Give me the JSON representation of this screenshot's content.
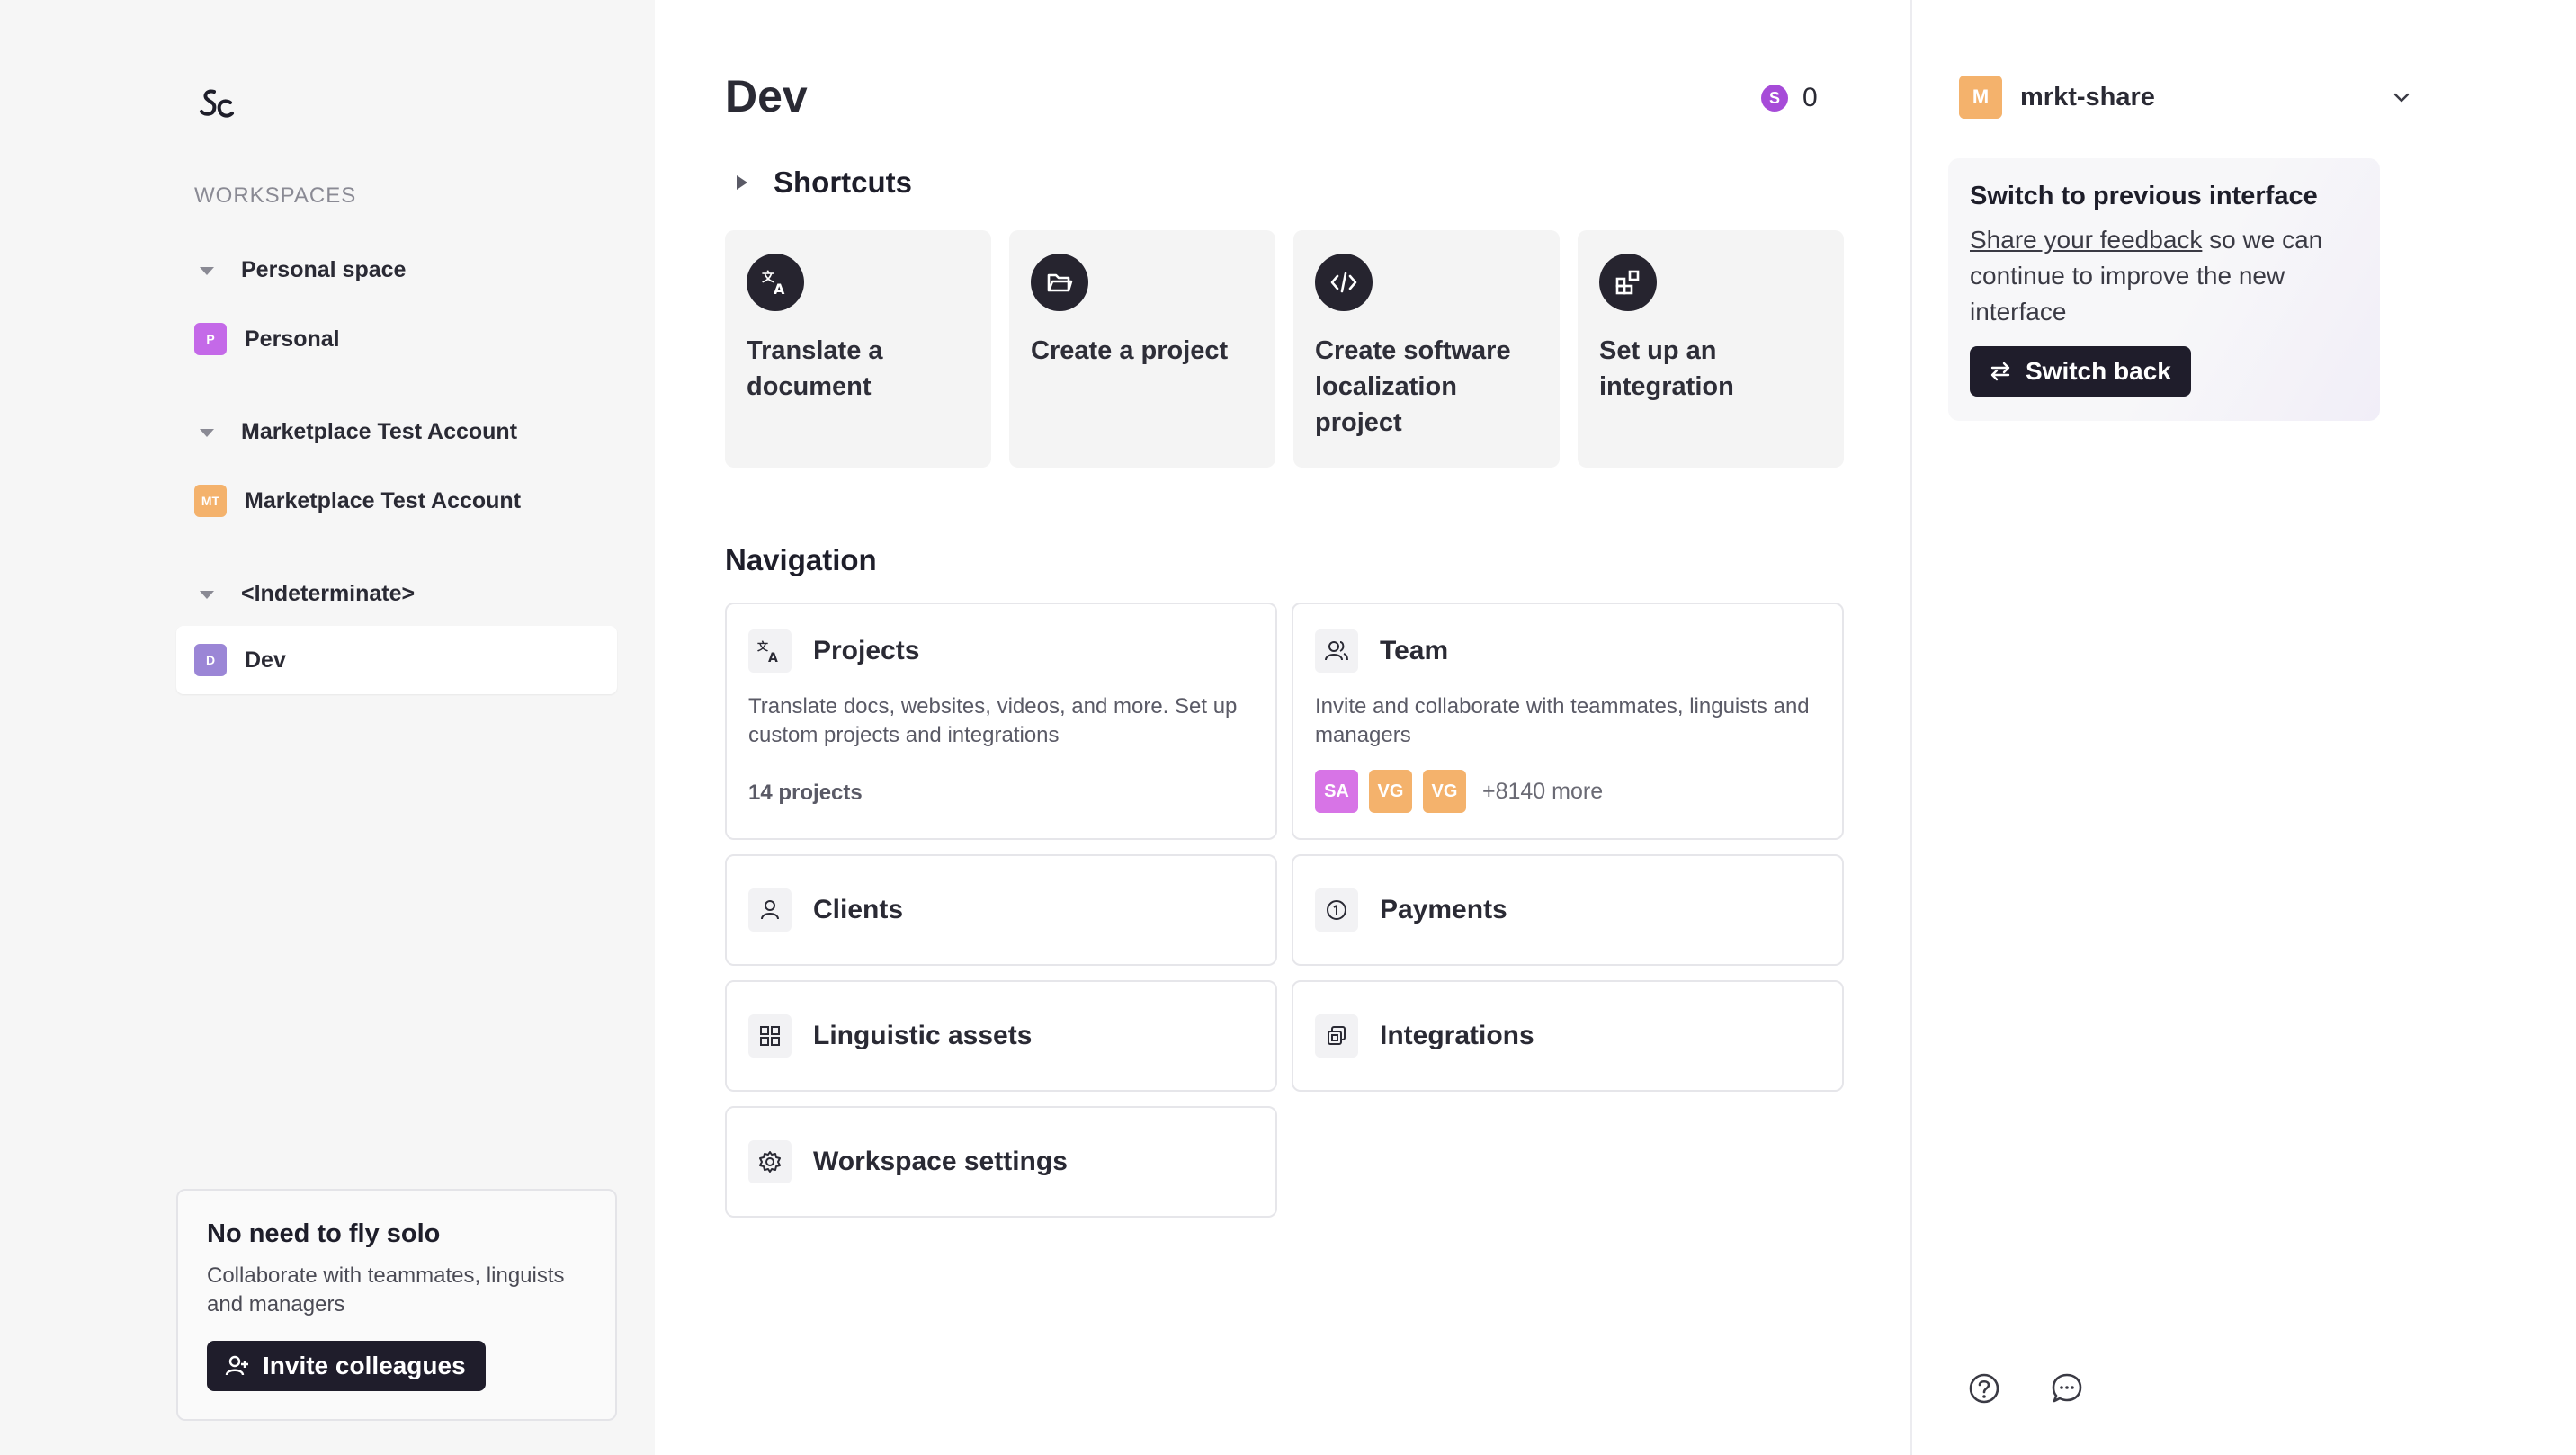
{
  "sidebar": {
    "workspaces_heading": "WORKSPACES",
    "groups": [
      {
        "name": "Personal space",
        "items": [
          {
            "badge": "P",
            "label": "Personal",
            "color": "#c469e8"
          }
        ]
      },
      {
        "name": "Marketplace Test Account",
        "items": [
          {
            "badge": "MT",
            "label": "Marketplace Test Account",
            "color": "#f4b26c"
          }
        ]
      },
      {
        "name": "<Indeterminate>",
        "items": [
          {
            "badge": "D",
            "label": "Dev",
            "color": "#9b86d6",
            "active": true
          }
        ]
      }
    ],
    "promo": {
      "title": "No need to fly solo",
      "text": "Collaborate with teammates, linguists and managers",
      "button": "Invite colleagues"
    }
  },
  "main": {
    "title": "Dev",
    "credits": {
      "symbol": "S",
      "value": "0",
      "color": "#a64bd8"
    },
    "shortcuts_heading": "Shortcuts",
    "shortcuts": [
      {
        "label": "Translate a document",
        "icon": "translate-icon"
      },
      {
        "label": "Create a project",
        "icon": "folder-open-icon"
      },
      {
        "label": "Create software localization project",
        "icon": "code-icon"
      },
      {
        "label": "Set up an integration",
        "icon": "integration-icon"
      }
    ],
    "navigation_heading": "Navigation",
    "cards": {
      "projects": {
        "title": "Projects",
        "desc": "Translate docs, websites, videos, and more. Set up custom projects and integrations",
        "meta": "14 projects"
      },
      "team": {
        "title": "Team",
        "desc": "Invite and collaborate with teammates, linguists and managers",
        "avatars": [
          {
            "initials": "SA",
            "color": "#d774e6"
          },
          {
            "initials": "VG",
            "color": "#f4b26c"
          },
          {
            "initials": "VG",
            "color": "#f4b26c"
          }
        ],
        "more": "+8140 more"
      },
      "clients": {
        "title": "Clients"
      },
      "payments": {
        "title": "Payments"
      },
      "linguistic_assets": {
        "title": "Linguistic assets"
      },
      "integrations": {
        "title": "Integrations"
      },
      "workspace_settings": {
        "title": "Workspace settings"
      }
    }
  },
  "right_panel": {
    "account": {
      "badge": "M",
      "name": "mrkt-share",
      "color": "#f4b26c"
    },
    "switch_box": {
      "title": "Switch to previous interface",
      "link_text": "Share your feedback",
      "text_rest": " so we can continue to improve the new interface",
      "button": "Switch back"
    },
    "bottom_icons": [
      "help-icon",
      "chat-icon"
    ]
  },
  "theme": {
    "dark": "#1f1d2b",
    "sidebar_bg": "#f6f6f6",
    "card_border": "#e6e6ea"
  }
}
